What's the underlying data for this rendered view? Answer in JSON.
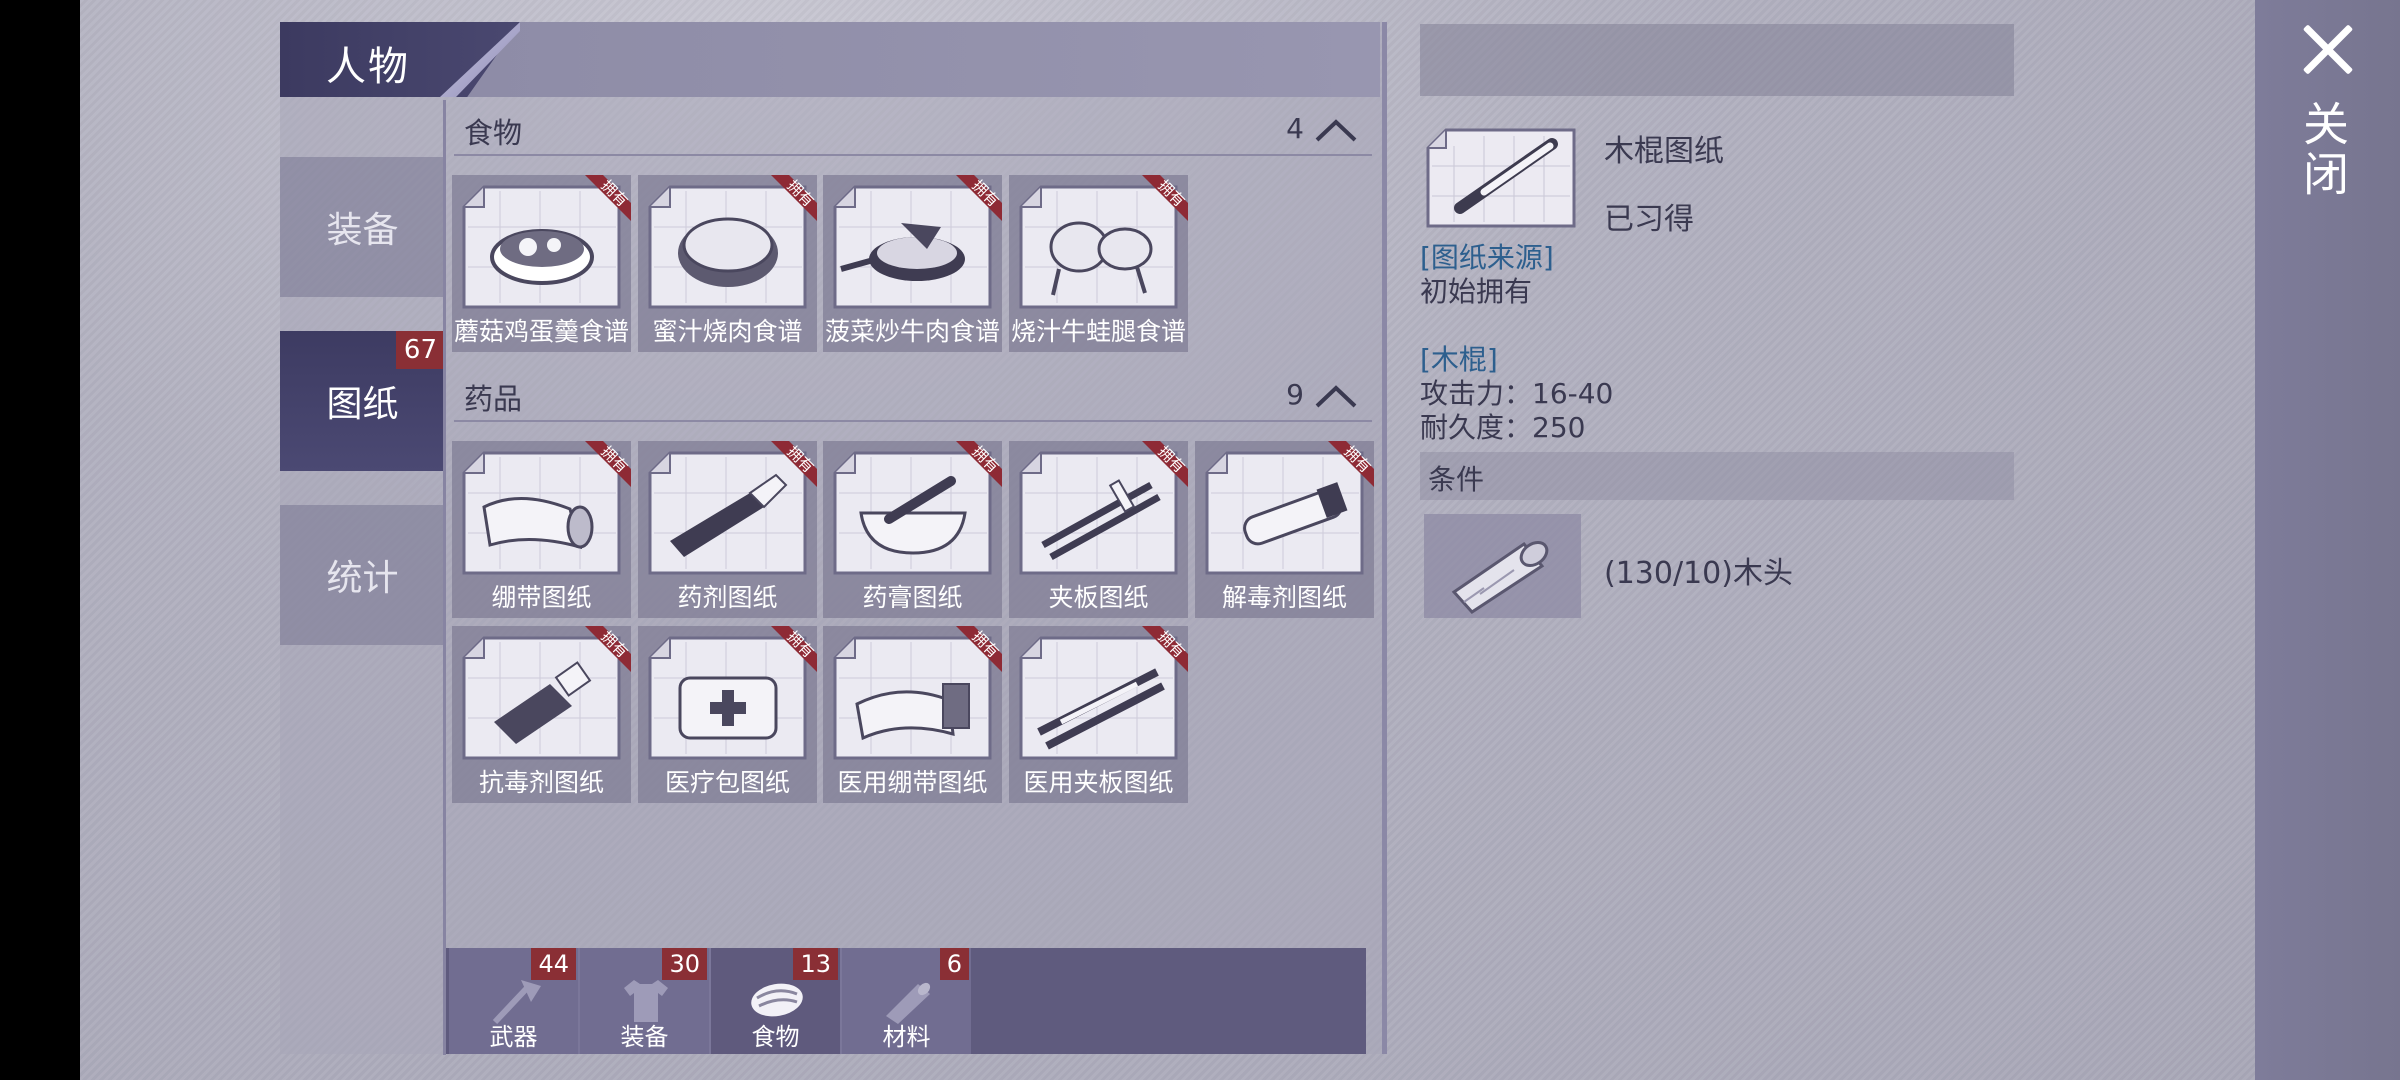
{
  "header": {
    "title": "人物"
  },
  "sidebar": {
    "tabs": [
      {
        "label": "装备"
      },
      {
        "label": "图纸",
        "badge": "67",
        "active": true
      },
      {
        "label": "统计"
      }
    ]
  },
  "sections": {
    "food": {
      "title": "食物",
      "count": "4",
      "items": [
        {
          "name": "蘑菇鸡蛋羹食谱",
          "tag": "拥有",
          "icon": "bowl-icon"
        },
        {
          "name": "蜜汁烧肉食谱",
          "tag": "拥有",
          "icon": "roast-meat-icon"
        },
        {
          "name": "菠菜炒牛肉食谱",
          "tag": "拥有",
          "icon": "frying-pan-icon"
        },
        {
          "name": "烧汁牛蛙腿食谱",
          "tag": "拥有",
          "icon": "frog-legs-icon"
        }
      ]
    },
    "medicine": {
      "title": "药品",
      "count": "9",
      "items": [
        {
          "name": "绷带图纸",
          "tag": "拥有",
          "icon": "bandage-icon"
        },
        {
          "name": "药剂图纸",
          "tag": "拥有",
          "icon": "syringe-icon"
        },
        {
          "name": "药膏图纸",
          "tag": "拥有",
          "icon": "mortar-icon"
        },
        {
          "name": "夹板图纸",
          "tag": "拥有",
          "icon": "splint-icon"
        },
        {
          "name": "解毒剂图纸",
          "tag": "拥有",
          "icon": "vial-icon"
        },
        {
          "name": "抗毒剂图纸",
          "tag": "拥有",
          "icon": "bottle-icon"
        },
        {
          "name": "医疗包图纸",
          "tag": "拥有",
          "icon": "medkit-icon"
        },
        {
          "name": "医用绷带图纸",
          "tag": "拥有",
          "icon": "medical-bandage-icon"
        },
        {
          "name": "医用夹板图纸",
          "tag": "拥有",
          "icon": "medical-splint-icon"
        }
      ]
    }
  },
  "bottom_tabs": [
    {
      "label": "武器",
      "badge": "44",
      "icon": "axe-icon"
    },
    {
      "label": "装备",
      "badge": "30",
      "icon": "shirt-icon"
    },
    {
      "label": "食物",
      "badge": "13",
      "icon": "meat-icon",
      "active": true
    },
    {
      "label": "材料",
      "badge": "6",
      "icon": "wood-icon"
    }
  ],
  "detail": {
    "name": "木棍图纸",
    "status": "已习得",
    "source_link": "[图纸来源]",
    "source_text": "初始拥有",
    "item_link": "[木棍]",
    "attack": "攻击力：16-40",
    "durability": "耐久度：250",
    "condition_title": "条件",
    "condition_text": "(130/10)木头"
  },
  "close": {
    "label": "关闭"
  },
  "colors": {
    "accent": "#3d3b62",
    "badge": "#8a2f35",
    "link": "#2d5f8e"
  }
}
